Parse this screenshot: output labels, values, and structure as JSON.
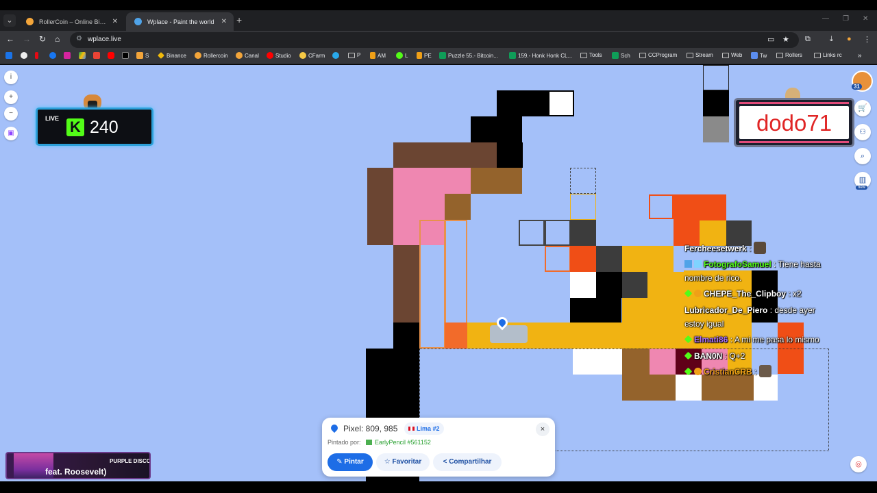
{
  "browser": {
    "tabs": [
      {
        "title": "RollerCoin – Online Bitcoin Min",
        "active": false
      },
      {
        "title": "Wplace - Paint the world",
        "active": true
      }
    ],
    "url": "wplace.live",
    "bookmarks": [
      "S",
      "Binance",
      "Rollercoin",
      "Canal",
      "Studio",
      "CFarm",
      "P",
      "AM",
      "L",
      "PE",
      "Puzzle 55.- Bitcoin...",
      "159.- Honk Honk CL...",
      "Tools",
      "Sch",
      "CCProgram",
      "Stream",
      "Web",
      "Tw",
      "Rollers",
      "Links rc"
    ]
  },
  "kick_widget": {
    "live_label": "LIVE",
    "logo": "K",
    "viewers": "240"
  },
  "user_panel": {
    "username": "dodo71"
  },
  "profile": {
    "badge": "31"
  },
  "sidebar": {
    "new_tag": "new"
  },
  "chat": [
    {
      "user": "Fercheesetwerk",
      "sep": " :",
      "text": "",
      "color": "#ffffff",
      "emote": true
    },
    {
      "user": "FotografoSamuel",
      "sep": " : ",
      "text": "Tiene hasta",
      "cont": "nombre de rico.",
      "color": "#53fc18",
      "badges": true
    },
    {
      "user": "CHEPE_The_Clipboy",
      "sep": " : ",
      "text": "x2",
      "color": "#ffffff",
      "badges": true
    },
    {
      "user": "Lubricador_De_Piero",
      "sep": " : ",
      "text": "desde ayer",
      "cont": "estoy igual",
      "color": "#ffffff"
    },
    {
      "user": "Elmati86",
      "sep": " : ",
      "text": "A mi me pasa lo mismo",
      "color": "#a970ff",
      "badges": true
    },
    {
      "user": "BAN0N",
      "sep": " : ",
      "text": "Q+2",
      "color": "#ffffff",
      "badges": true
    },
    {
      "user": "CristianCRB",
      "sep": " :",
      "text": "",
      "color": "#f0a017",
      "badges": true,
      "emote": true
    }
  ],
  "pixel_card": {
    "pixel_label": "Pixel: 809, 985",
    "region": "Lima #2",
    "painted_label": "Pintado por:",
    "painter": "EarlyPencil #561152",
    "buttons": {
      "paint": "Pintar",
      "favorite": "Favoritar",
      "share": "Compartilhar"
    },
    "close": "×"
  },
  "music": {
    "title": "PURPLE DISCO",
    "subtitle": "feat. Roosevelt)"
  },
  "colors": {
    "map_bg": "#a4c0f9",
    "accent": "#1d6de6",
    "kick_green": "#53fc18"
  }
}
